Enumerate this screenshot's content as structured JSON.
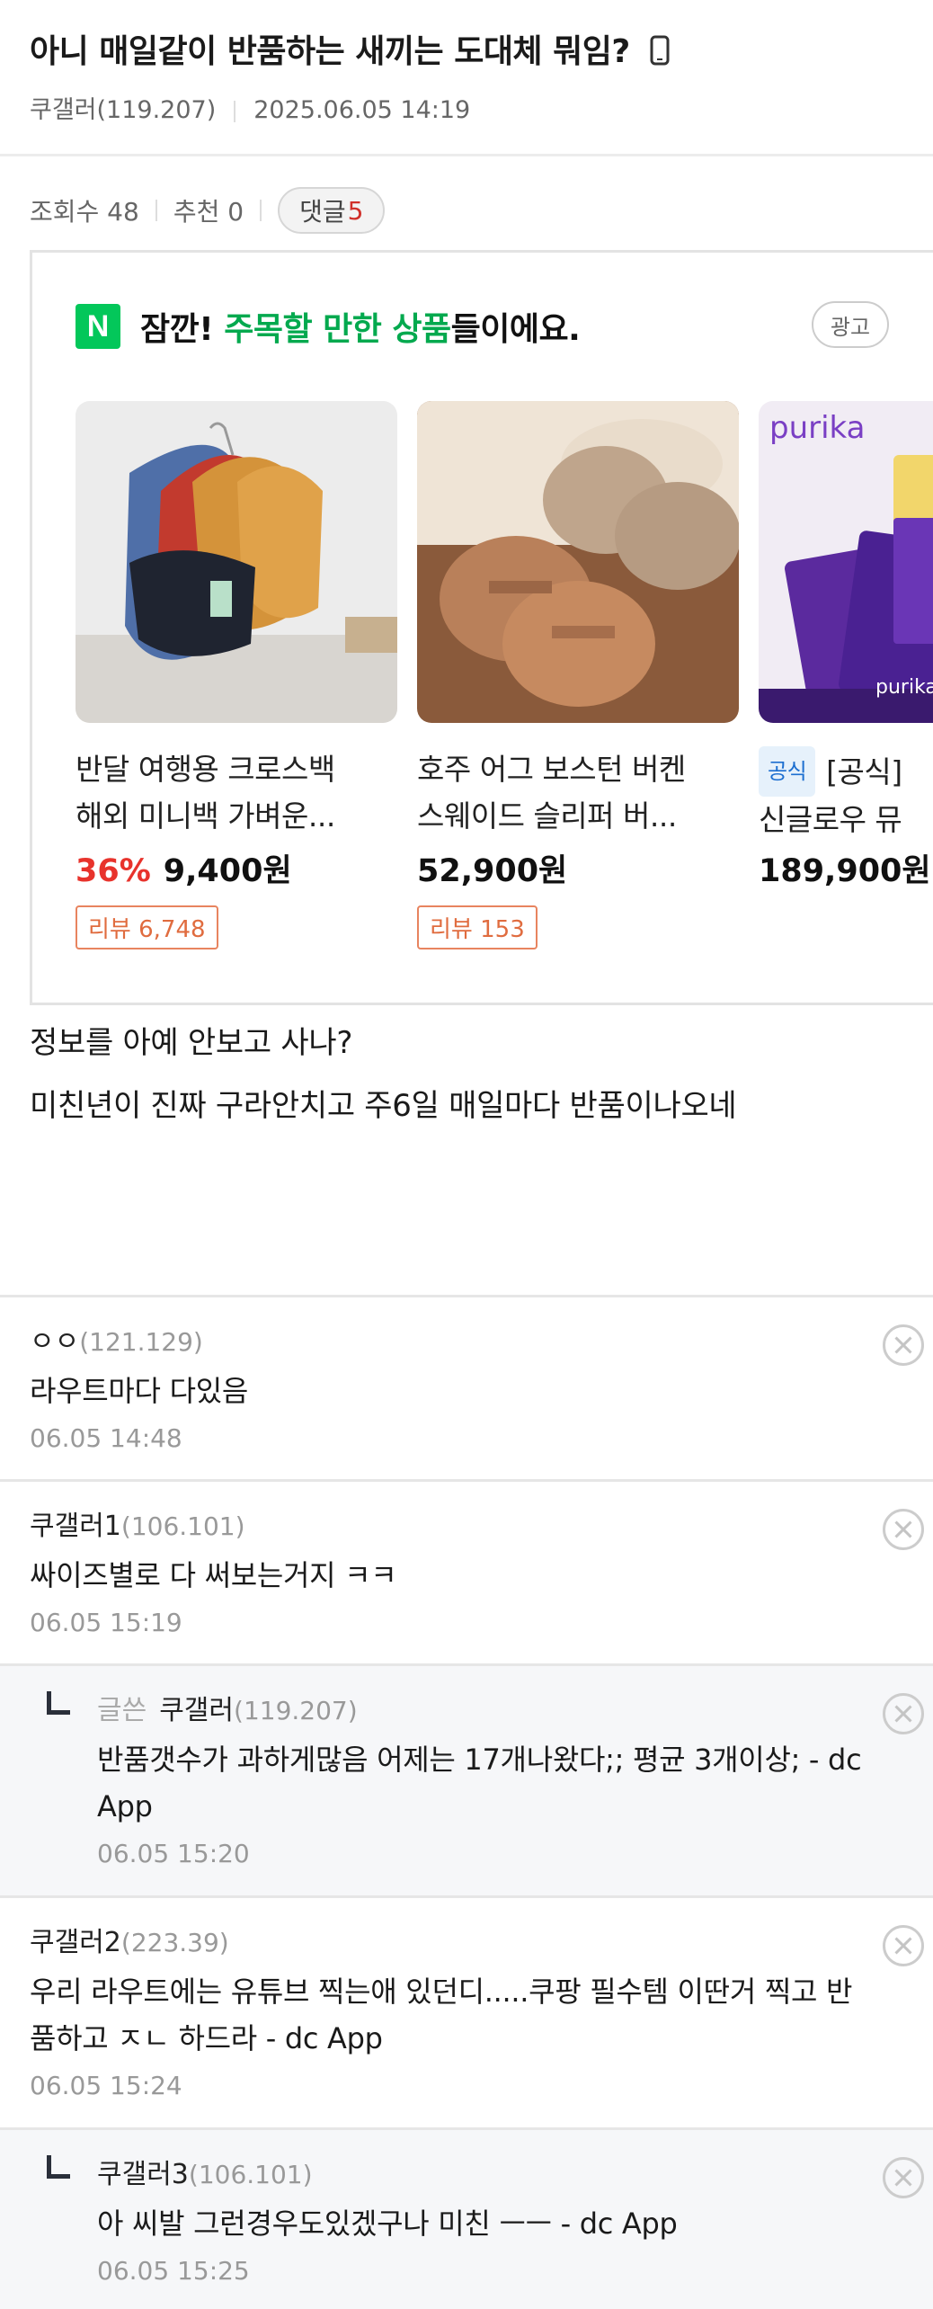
{
  "post": {
    "title": "아니 매일같이 반품하는 새끼는 도대체 뭐임?",
    "author": "쿠갤러(119.207)",
    "datetime": "2025.06.05 14:19",
    "views_label": "조회수 48",
    "recommend_label": "추천 0",
    "comments_label": "댓글",
    "comments_count": "5"
  },
  "ad": {
    "headline_pre": "잠깐! ",
    "headline_highlight": "주목할 만한 상품",
    "headline_post": "들이에요.",
    "badge": "광고",
    "logo_letter": "N",
    "accent_color": "#03c75a",
    "products": [
      {
        "title_line1": "반달 여행용 크로스백",
        "title_line2": "해외 미니백 가벼운...",
        "discount": "36%",
        "price": "9,400원",
        "review": "리뷰 6,748"
      },
      {
        "title_line1": "호주 어그 보스턴 버켄",
        "title_line2": "스웨이드 슬리퍼 버...",
        "price": "52,900원",
        "review": "리뷰 153"
      },
      {
        "tag": "공식",
        "title_line1": "[공식]",
        "title_line2": "신글로우 뮤",
        "price": "189,900원",
        "brand": "purika",
        "pack_text": "purika"
      }
    ]
  },
  "body": {
    "line1": "정보를 아예 안보고 사나?",
    "line2": "미친년이 진짜 구라안치고 주6일 매일마다 반품이나오네"
  },
  "comments": [
    {
      "name": "ㅇㅇ",
      "ip": "(121.129)",
      "text_line1": "라우트마다 다있음",
      "date": "06.05 14:48"
    },
    {
      "name": "쿠갤러1",
      "ip": "(106.101)",
      "text_line1": "싸이즈별로 다 써보는거지 ㅋㅋ",
      "date": "06.05 15:19"
    },
    {
      "author_tag": "글쓴",
      "name": "쿠갤러",
      "ip": "(119.207)",
      "text_line1": "반품갯수가 과하게많음 어제는 17개나왔다;; 평균 3개이상; - dc",
      "text_line2": "App",
      "date": "06.05 15:20"
    },
    {
      "name": "쿠갤러2",
      "ip": "(223.39)",
      "text_line1": "우리 라우트에는 유튜브 찍는애 있던디.....쿠팡 필수템 이딴거 찍고 반",
      "text_line2": "품하고 ㅈㄴ 하드라 - dc App",
      "date": "06.05 15:24"
    },
    {
      "name": "쿠갤러3",
      "ip": "(106.101)",
      "text_line1": "아 씨발 그런경우도있겠구나 미친 ㅡㅡ - dc App",
      "date": "06.05 15:25"
    }
  ]
}
